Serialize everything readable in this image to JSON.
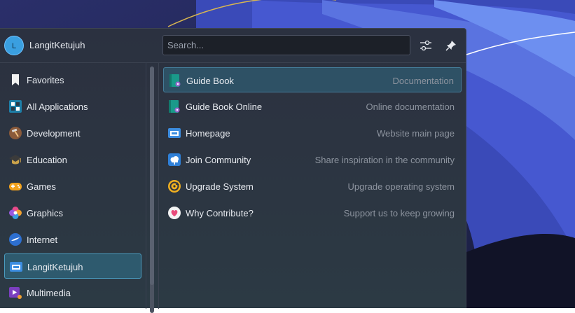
{
  "header": {
    "avatar_initial": "L",
    "username": "LangitKetujuh",
    "search_placeholder": "Search..."
  },
  "sidebar": {
    "items": [
      {
        "label": "Favorites",
        "icon": "bookmark-icon"
      },
      {
        "label": "All Applications",
        "icon": "grid-icon"
      },
      {
        "label": "Development",
        "icon": "hammer-icon"
      },
      {
        "label": "Education",
        "icon": "graduation-cap-icon"
      },
      {
        "label": "Games",
        "icon": "gamepad-icon"
      },
      {
        "label": "Graphics",
        "icon": "graphics-flower-icon"
      },
      {
        "label": "Internet",
        "icon": "globe-icon"
      },
      {
        "label": "LangitKetujuh",
        "icon": "window-icon",
        "selected": true
      },
      {
        "label": "Multimedia",
        "icon": "multimedia-icon"
      }
    ]
  },
  "apps": {
    "items": [
      {
        "name": "Guide Book",
        "description": "Documentation",
        "icon": "book-icon",
        "highlighted": true
      },
      {
        "name": "Guide Book Online",
        "description": "Online documentation",
        "icon": "book-icon"
      },
      {
        "name": "Homepage",
        "description": "Website main page",
        "icon": "window-icon"
      },
      {
        "name": "Join Community",
        "description": "Share inspiration in the community",
        "icon": "cloud-icon"
      },
      {
        "name": "Upgrade System",
        "description": "Upgrade operating system",
        "icon": "upgrade-icon"
      },
      {
        "name": "Why Contribute?",
        "description": "Support us to keep growing",
        "icon": "heart-icon"
      }
    ]
  },
  "colors": {
    "accent": "#3daee9",
    "panel": "#2c3441",
    "selection": "#2e5a6e"
  }
}
